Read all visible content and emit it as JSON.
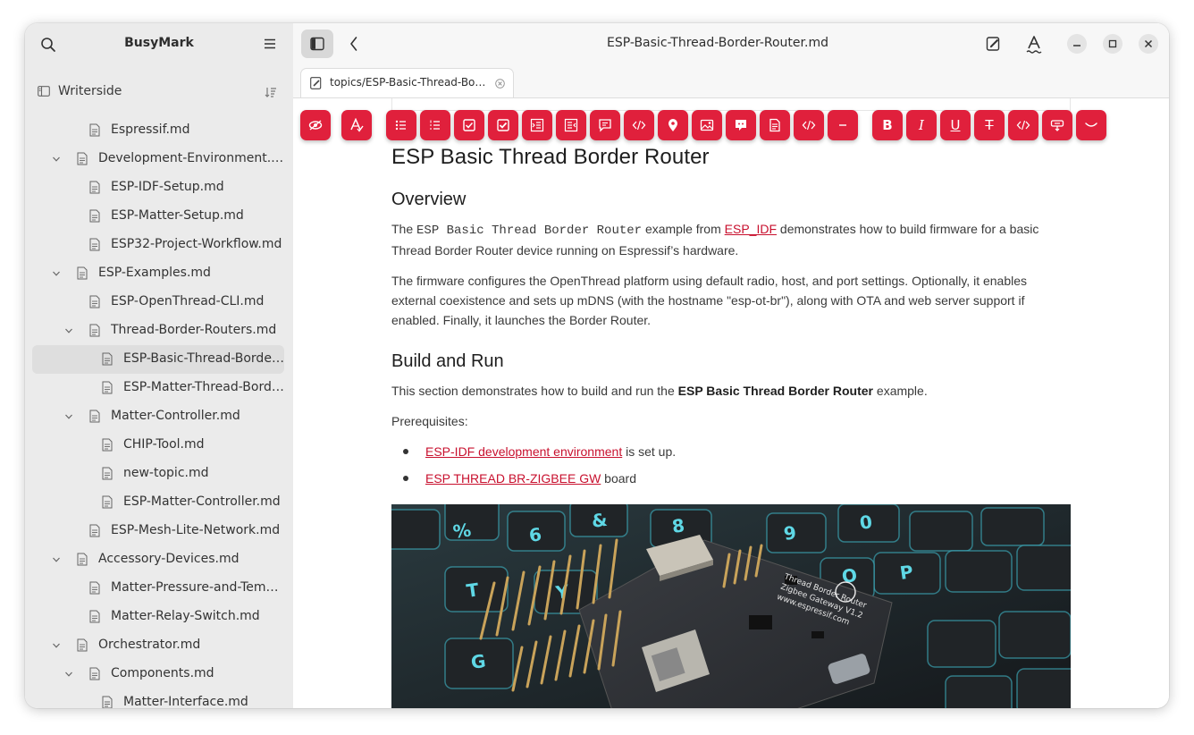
{
  "app": {
    "name": "BusyMark",
    "window_title": "ESP-Basic-Thread-Border-Router.md"
  },
  "sidebar": {
    "workspace": "Writerside",
    "tree": [
      {
        "label": "Espressif.md",
        "level": 2,
        "expander": false
      },
      {
        "label": "Development-Environment.md",
        "level": 1,
        "expander": true
      },
      {
        "label": "ESP-IDF-Setup.md",
        "level": 2,
        "expander": false
      },
      {
        "label": "ESP-Matter-Setup.md",
        "level": 2,
        "expander": false
      },
      {
        "label": "ESP32-Project-Workflow.md",
        "level": 2,
        "expander": false
      },
      {
        "label": "ESP-Examples.md",
        "level": 1,
        "expander": true
      },
      {
        "label": "ESP-OpenThread-CLI.md",
        "level": 2,
        "expander": false
      },
      {
        "label": "Thread-Border-Routers.md",
        "level": 2,
        "expander": true
      },
      {
        "label": "ESP-Basic-Thread-Border-Router.md",
        "level": 3,
        "expander": false,
        "selected": true
      },
      {
        "label": "ESP-Matter-Thread-Border-Router.md",
        "level": 3,
        "expander": false
      },
      {
        "label": "Matter-Controller.md",
        "level": 2,
        "expander": true
      },
      {
        "label": "CHIP-Tool.md",
        "level": 3,
        "expander": false
      },
      {
        "label": "new-topic.md",
        "level": 3,
        "expander": false
      },
      {
        "label": "ESP-Matter-Controller.md",
        "level": 3,
        "expander": false
      },
      {
        "label": "ESP-Mesh-Lite-Network.md",
        "level": 2,
        "expander": false
      },
      {
        "label": "Accessory-Devices.md",
        "level": 1,
        "expander": true
      },
      {
        "label": "Matter-Pressure-and-Temperature.md",
        "level": 2,
        "expander": false
      },
      {
        "label": "Matter-Relay-Switch.md",
        "level": 2,
        "expander": false
      },
      {
        "label": "Orchestrator.md",
        "level": 1,
        "expander": true
      },
      {
        "label": "Components.md",
        "level": 2,
        "expander": true
      },
      {
        "label": "Matter-Interface.md",
        "level": 3,
        "expander": false
      }
    ]
  },
  "tab": {
    "label": "topics/ESP-Basic-Thread-Border-Router.md"
  },
  "toolbar": {
    "accent": "#e0203c",
    "buttons": [
      {
        "name": "hide-preview-button",
        "icon": "eye-off-icon"
      },
      {
        "name": "spellcheck-button",
        "icon": "spellcheck-icon"
      },
      {
        "name": "bulleted-list-button",
        "icon": "bulleted-list-icon"
      },
      {
        "name": "numbered-list-button",
        "icon": "numbered-list-icon"
      },
      {
        "name": "task-list-button",
        "icon": "checkbox-icon"
      },
      {
        "name": "checked-task-button",
        "icon": "checkbox-checked-icon"
      },
      {
        "name": "indent-button",
        "icon": "indent-icon"
      },
      {
        "name": "outdent-button",
        "icon": "outdent-icon"
      },
      {
        "name": "comment-button",
        "icon": "comment-icon"
      },
      {
        "name": "code-button",
        "icon": "code-icon"
      },
      {
        "name": "location-button",
        "icon": "map-pin-icon"
      },
      {
        "name": "image-button",
        "icon": "image-icon"
      },
      {
        "name": "callout-button",
        "icon": "callout-icon"
      },
      {
        "name": "document-button",
        "icon": "document-icon"
      },
      {
        "name": "code-block-button",
        "icon": "code-block-icon"
      },
      {
        "name": "horizontal-rule-button",
        "icon": "minus-icon"
      },
      {
        "name": "bold-button",
        "icon": "bold-icon",
        "text": "B"
      },
      {
        "name": "italic-button",
        "icon": "italic-icon",
        "text": "I"
      },
      {
        "name": "underline-button",
        "icon": "underline-icon",
        "text": "U"
      },
      {
        "name": "strikethrough-button",
        "icon": "strikethrough-icon",
        "text": "T"
      },
      {
        "name": "inline-code-button",
        "icon": "inline-code-icon"
      },
      {
        "name": "link-button",
        "icon": "link-icon"
      },
      {
        "name": "more-button",
        "icon": "chevron-down-icon"
      }
    ]
  },
  "document": {
    "title": "ESP Basic Thread Border Router",
    "overview_heading": "Overview",
    "overview_p1": {
      "before": "The ",
      "code": "ESP Basic Thread Border Router",
      "middle": " example from ",
      "link": "ESP_IDF",
      "after": " demonstrates how to build firmware for a basic Thread Border Router device running on Espressif’s hardware."
    },
    "overview_p2": "The firmware configures the OpenThread platform using default radio, host, and port settings. Optionally, it enables external coexistence and sets up mDNS (with the hostname \"esp-ot-br\"), along with OTA and web server support if enabled. Finally, it launches the Border Router.",
    "build_heading": "Build and Run",
    "build_p": {
      "before": "This section demonstrates how to build and run the ",
      "bold": "ESP Basic Thread Border Router",
      "after": " example."
    },
    "prereq_label": "Prerequisites:",
    "prereqs": [
      {
        "link": "ESP-IDF development environment",
        "text": " is set up."
      },
      {
        "link": "ESP THREAD BR-ZIGBEE GW",
        "text": " board"
      }
    ],
    "photo": {
      "board_text_1": "Thread Border Router",
      "board_text_2": "Zigbee Gateway V1.2",
      "board_text_3": "www.espressif.com"
    }
  }
}
